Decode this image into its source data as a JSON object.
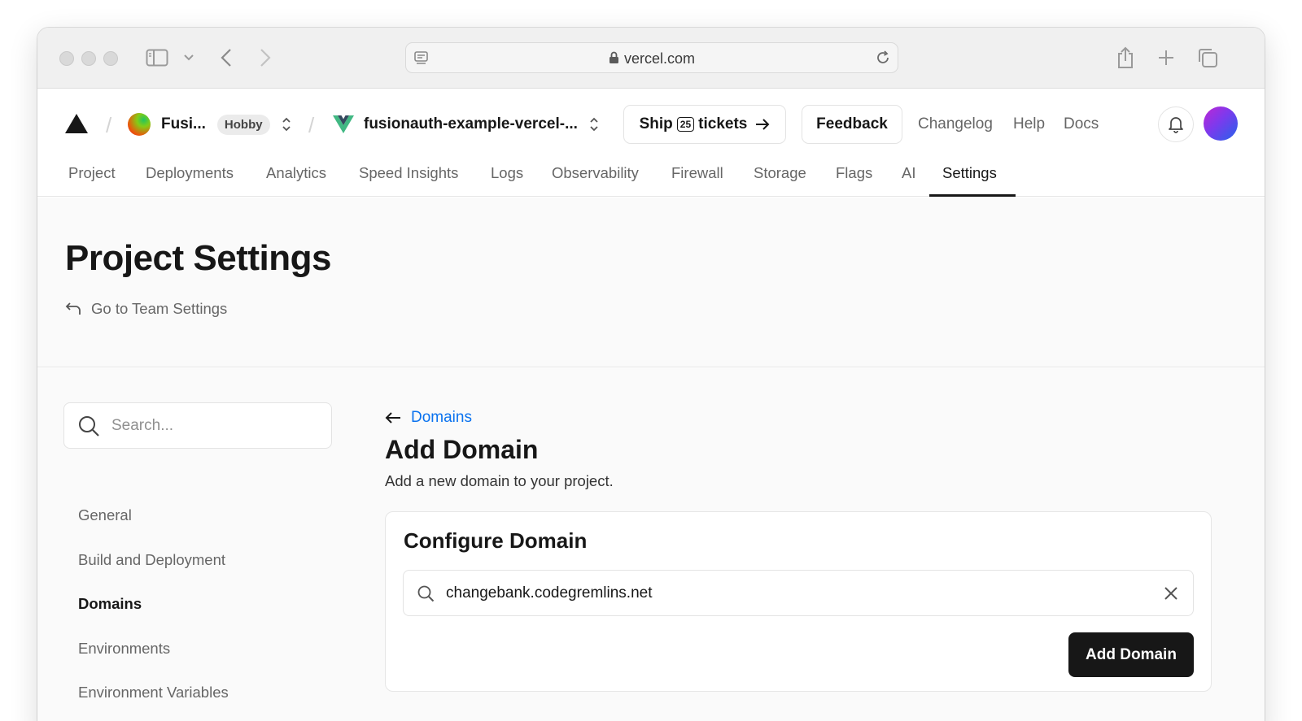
{
  "browser": {
    "url": "vercel.com"
  },
  "header": {
    "team_name": "Fusi...",
    "plan_badge": "Hobby",
    "project_name": "fusionauth-example-vercel-...",
    "ship_label_start": "Ship",
    "ship_count": "25",
    "ship_label_end": "tickets",
    "feedback_label": "Feedback",
    "links": [
      "Changelog",
      "Help",
      "Docs"
    ],
    "colors": {
      "brand": "#171717",
      "link": "#0a72ef"
    }
  },
  "tabs": [
    "Project",
    "Deployments",
    "Analytics",
    "Speed Insights",
    "Logs",
    "Observability",
    "Firewall",
    "Storage",
    "Flags",
    "AI",
    "Settings"
  ],
  "active_tab": "Settings",
  "page": {
    "title": "Project Settings",
    "back_link": "Go to Team Settings"
  },
  "sidebar": {
    "search_placeholder": "Search...",
    "items": [
      "General",
      "Build and Deployment",
      "Domains",
      "Environments",
      "Environment Variables"
    ],
    "active_item": "Domains"
  },
  "main": {
    "breadcrumb": "Domains",
    "heading": "Add Domain",
    "description": "Add a new domain to your project.",
    "card": {
      "title": "Configure Domain",
      "domain_value": "changebank.codegremlins.net",
      "submit_label": "Add Domain"
    }
  }
}
